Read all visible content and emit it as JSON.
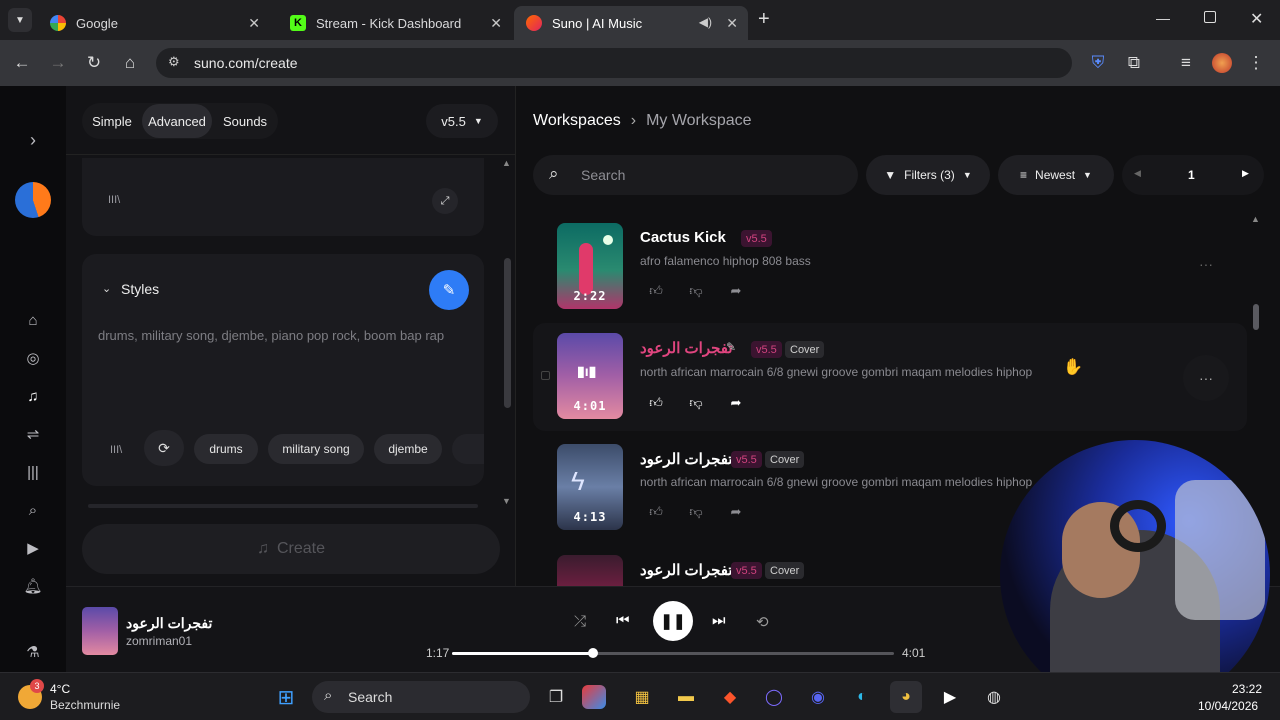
{
  "browser": {
    "tabs": [
      {
        "title": "Google",
        "active": false
      },
      {
        "title": "Stream - Kick Dashboard",
        "active": false
      },
      {
        "title": "Suno | AI Music",
        "active": true
      }
    ],
    "url": "suno.com/create"
  },
  "create_panel": {
    "mode_tabs": [
      "Simple",
      "Advanced",
      "Sounds"
    ],
    "selected_mode": "Advanced",
    "model_version": "v5.5",
    "lyrics_icon_text": "III\\",
    "styles_label": "Styles",
    "styles_text": "drums, military song, djembe, piano pop rock, boom bap rap",
    "style_chips": [
      "drums",
      "military song",
      "djembe"
    ],
    "create_label": "Create"
  },
  "workspace": {
    "breadcrumb_root": "Workspaces",
    "breadcrumb_current": "My Workspace",
    "search_placeholder": "Search",
    "filters_label": "Filters (3)",
    "sort_label": "Newest",
    "page_number": "1"
  },
  "songs": [
    {
      "title": "Cactus Kick",
      "version": "v5.5",
      "tag": "",
      "description": "afro falamenco hiphop 808 bass",
      "duration": "2:22",
      "title_color": "#ffffff"
    },
    {
      "title": "تفجرات الرعود",
      "version": "v5.5",
      "tag": "Cover",
      "description": "north african marrocain 6/8 gnewi groove gombri maqam melodies hiphop",
      "duration": "4:01",
      "title_color": "#e0457f"
    },
    {
      "title": "تفجرات الرعود",
      "version": "v5.5",
      "tag": "Cover",
      "description": "north african marrocain 6/8 gnewi groove gombri maqam melodies hiphop",
      "duration": "4:13",
      "title_color": "#ffffff"
    },
    {
      "title": "تفجرات الرعود",
      "version": "v5.5",
      "tag": "Cover",
      "description": "",
      "duration": "",
      "title_color": "#ffffff"
    }
  ],
  "player": {
    "track_title": "تفجرات الرعود",
    "artist": "zomriman01",
    "elapsed": "1:17",
    "total": "4:01",
    "progress": 0.32
  },
  "taskbar": {
    "weather_temp": "4°C",
    "weather_location": "Bezchmurnie",
    "weather_badge": "3",
    "search_label": "Search",
    "time": "23:22",
    "date": "10/04/2026"
  },
  "colors": {
    "accent_blue": "#2e7cf6",
    "version_pink": "#d2437f",
    "background": "#101012"
  }
}
